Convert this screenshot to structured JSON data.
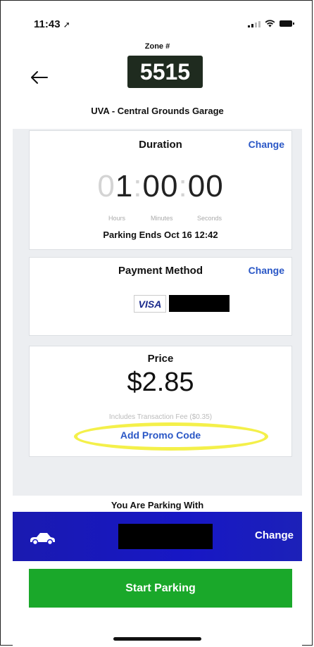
{
  "status_bar": {
    "time": "11:43"
  },
  "header": {
    "zone_label": "Zone #",
    "zone_number": "5515",
    "location": "UVA - Central Grounds Garage"
  },
  "duration": {
    "title": "Duration",
    "change_label": "Change",
    "timer": {
      "hours_lead": "0",
      "hours": "1",
      "minutes": "00",
      "seconds": "00",
      "sep": ":"
    },
    "units": {
      "hours": "Hours",
      "minutes": "Minutes",
      "seconds": "Seconds"
    },
    "parking_ends": "Parking Ends Oct 16 12:42"
  },
  "payment": {
    "title": "Payment Method",
    "change_label": "Change",
    "card_brand": "VISA"
  },
  "price": {
    "title": "Price",
    "amount": "$2.85",
    "fee_note": "Includes Transaction Fee ($0.35)",
    "promo_label": "Add Promo Code"
  },
  "vehicle": {
    "label": "You Are Parking With",
    "change_label": "Change"
  },
  "actions": {
    "start_label": "Start Parking"
  },
  "colors": {
    "accent_link": "#2a57c6",
    "vehicle_bar": "#1717c5",
    "start_button": "#1aa82a",
    "zone_badge": "#1f2b1f",
    "highlight": "#f4f04a"
  }
}
